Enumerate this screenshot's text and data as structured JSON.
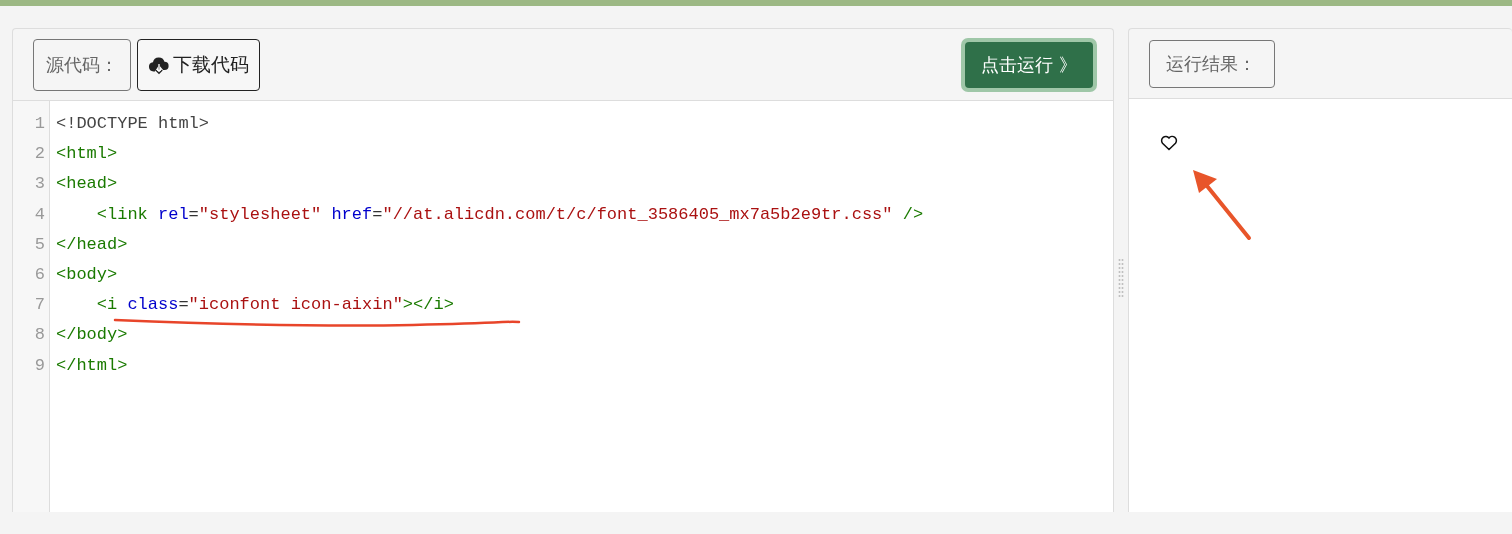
{
  "editor": {
    "source_label": "源代码：",
    "download_button": "下载代码",
    "run_button": "点击运行 》",
    "lines": [
      {
        "number": "1",
        "indented": false,
        "tokens": [
          {
            "kind": "meta",
            "text": "<!DOCTYPE html>"
          }
        ]
      },
      {
        "number": "2",
        "indented": false,
        "tokens": [
          {
            "kind": "tag",
            "text": "<html>"
          }
        ]
      },
      {
        "number": "3",
        "indented": false,
        "tokens": [
          {
            "kind": "tag",
            "text": "<head>"
          }
        ]
      },
      {
        "number": "4",
        "indented": true,
        "tokens": [
          {
            "kind": "tag",
            "text": "<link"
          },
          {
            "kind": "attr",
            "text": "rel",
            "gap": true
          },
          {
            "kind": "plain",
            "text": "="
          },
          {
            "kind": "string",
            "text": "\"stylesheet\""
          },
          {
            "kind": "attr",
            "text": "href",
            "gap": true
          },
          {
            "kind": "plain",
            "text": "="
          },
          {
            "kind": "string",
            "text": "\"//at.alicdn.com/t/c/font_3586405_mx7a5b2e9tr.css\""
          },
          {
            "kind": "tag",
            "text": "/>",
            "gap": true
          }
        ]
      },
      {
        "number": "5",
        "indented": false,
        "tokens": [
          {
            "kind": "tag",
            "text": "</head>"
          }
        ]
      },
      {
        "number": "6",
        "indented": false,
        "tokens": [
          {
            "kind": "tag",
            "text": "<body>"
          }
        ]
      },
      {
        "number": "7",
        "indented": true,
        "tokens": [
          {
            "kind": "tag",
            "text": "<i"
          },
          {
            "kind": "attr",
            "text": "class",
            "gap": true
          },
          {
            "kind": "plain",
            "text": "="
          },
          {
            "kind": "string",
            "text": "\"iconfont icon-aixin\""
          },
          {
            "kind": "tag",
            "text": "></i>"
          }
        ]
      },
      {
        "number": "8",
        "indented": false,
        "tokens": [
          {
            "kind": "tag",
            "text": "</body>"
          }
        ]
      },
      {
        "number": "9",
        "indented": false,
        "tokens": [
          {
            "kind": "tag",
            "text": "</html>"
          }
        ]
      }
    ]
  },
  "result": {
    "label": "运行结果："
  }
}
